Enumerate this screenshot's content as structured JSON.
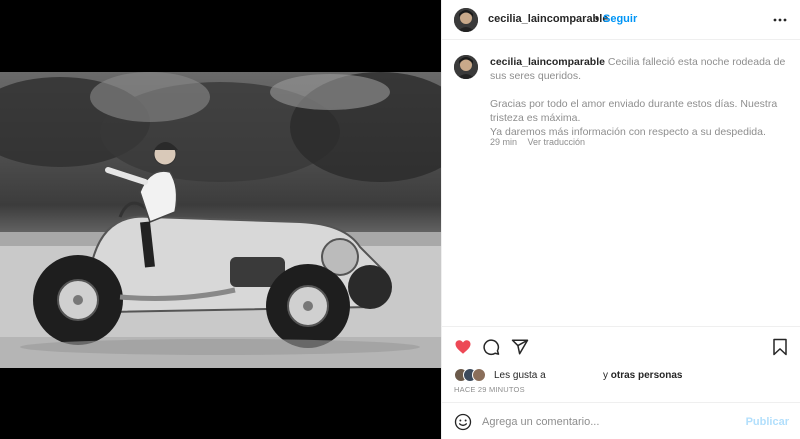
{
  "post": {
    "image_alt": "Foto en blanco y negro de una mujer en un auto de carrera antiguo",
    "header": {
      "username": "cecilia_laincomparable",
      "separator": "•",
      "follow_label": "Seguir",
      "more_icon": "more-horizontal-icon"
    },
    "caption": {
      "username": "cecilia_laincomparable",
      "line1": "Cecilia falleció esta noche rodeada de sus seres queridos.",
      "line2": "Gracias por todo el amor enviado durante estos días. Nuestra tristeza es máxima.",
      "line3": "Ya daremos más información con respecto a su despedida.",
      "time": "29 min",
      "translate_label": "Ver traducción"
    },
    "actions": {
      "like_icon": "heart-icon",
      "comment_icon": "comment-icon",
      "share_icon": "share-icon",
      "save_icon": "bookmark-icon",
      "like_color": "#ed4956"
    },
    "likes": {
      "prefix": "Les gusta a",
      "others": "otras personas",
      "conjunction": "y",
      "time_ago": "HACE 29 MINUTOS"
    },
    "comment_box": {
      "placeholder": "Agrega un comentario...",
      "publish_label": "Publicar",
      "emoji_icon": "emoji-icon"
    }
  },
  "colors": {
    "accent": "#0095f6",
    "muted": "#8e8e8e",
    "text": "#262626",
    "publish_disabled": "#b2dffc",
    "border": "#efefef"
  }
}
